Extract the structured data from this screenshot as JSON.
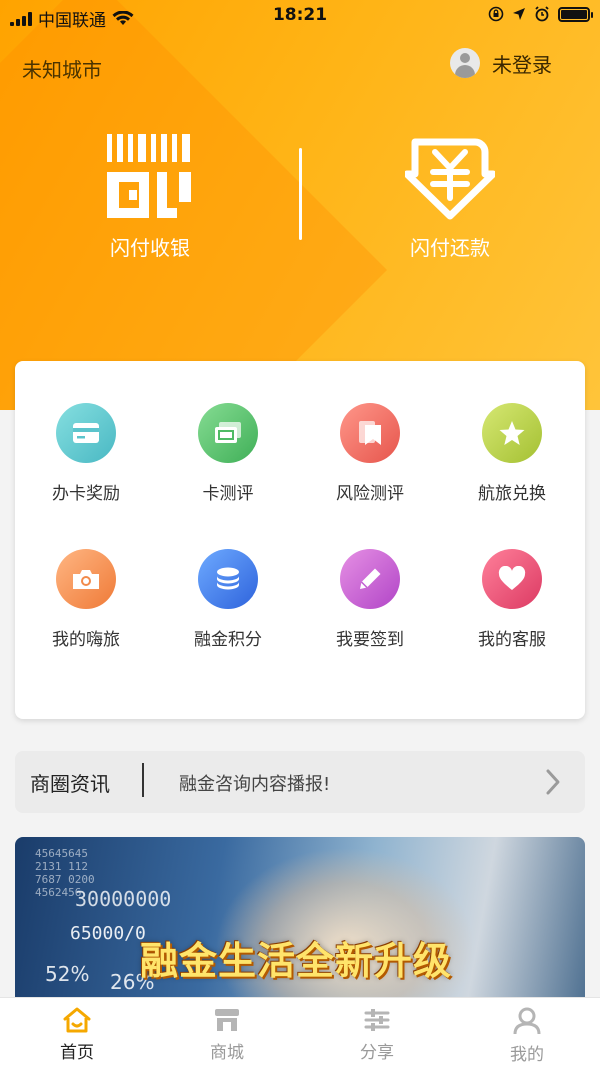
{
  "status_bar": {
    "carrier": "中国联通",
    "time": "18:21"
  },
  "header": {
    "city": "未知城市",
    "login_text": "未登录"
  },
  "actions": [
    {
      "label": "闪付收银",
      "icon": "barcode-scan-icon"
    },
    {
      "label": "闪付还款",
      "icon": "yuan-repay-icon"
    }
  ],
  "grid": [
    {
      "label": "办卡奖励",
      "icon": "card-icon",
      "color_from": "#7fd6d8",
      "color_to": "#4cbcc4"
    },
    {
      "label": "卡测评",
      "icon": "cards-icon",
      "color_from": "#7ed58a",
      "color_to": "#3fb25a"
    },
    {
      "label": "风险测评",
      "icon": "bookmark-icon",
      "color_from": "#ff8f80",
      "color_to": "#e9584f"
    },
    {
      "label": "航旅兑换",
      "icon": "star-icon",
      "color_from": "#d2e46a",
      "color_to": "#a9c43a"
    },
    {
      "label": "我的嗨旅",
      "icon": "camera-icon",
      "color_from": "#ffb27a",
      "color_to": "#f07b3a"
    },
    {
      "label": "融金积分",
      "icon": "coins-icon",
      "color_from": "#6aa7ff",
      "color_to": "#3168e0"
    },
    {
      "label": "我要签到",
      "icon": "pencil-icon",
      "color_from": "#e38be0",
      "color_to": "#b548c9"
    },
    {
      "label": "我的客服",
      "icon": "heart-icon",
      "color_from": "#ff7a95",
      "color_to": "#e03d66"
    }
  ],
  "news": {
    "title": "商圈资讯",
    "text": "融金咨询内容播报!"
  },
  "banner": {
    "slogan": "融金生活全新升级",
    "numbers": "45645645\n2131 112\n7687 0200\n4562456",
    "big_number": "30000000",
    "small_number": "65000/0",
    "percent_left": "52%",
    "percent_right": "26%"
  },
  "tabs": [
    {
      "label": "首页",
      "icon": "home-icon",
      "active": true
    },
    {
      "label": "商城",
      "icon": "shop-icon",
      "active": false
    },
    {
      "label": "分享",
      "icon": "share-icon",
      "active": false
    },
    {
      "label": "我的",
      "icon": "user-icon",
      "active": false
    }
  ],
  "colors": {
    "accent": "#ffb300",
    "active_tab": "#f5a800"
  }
}
